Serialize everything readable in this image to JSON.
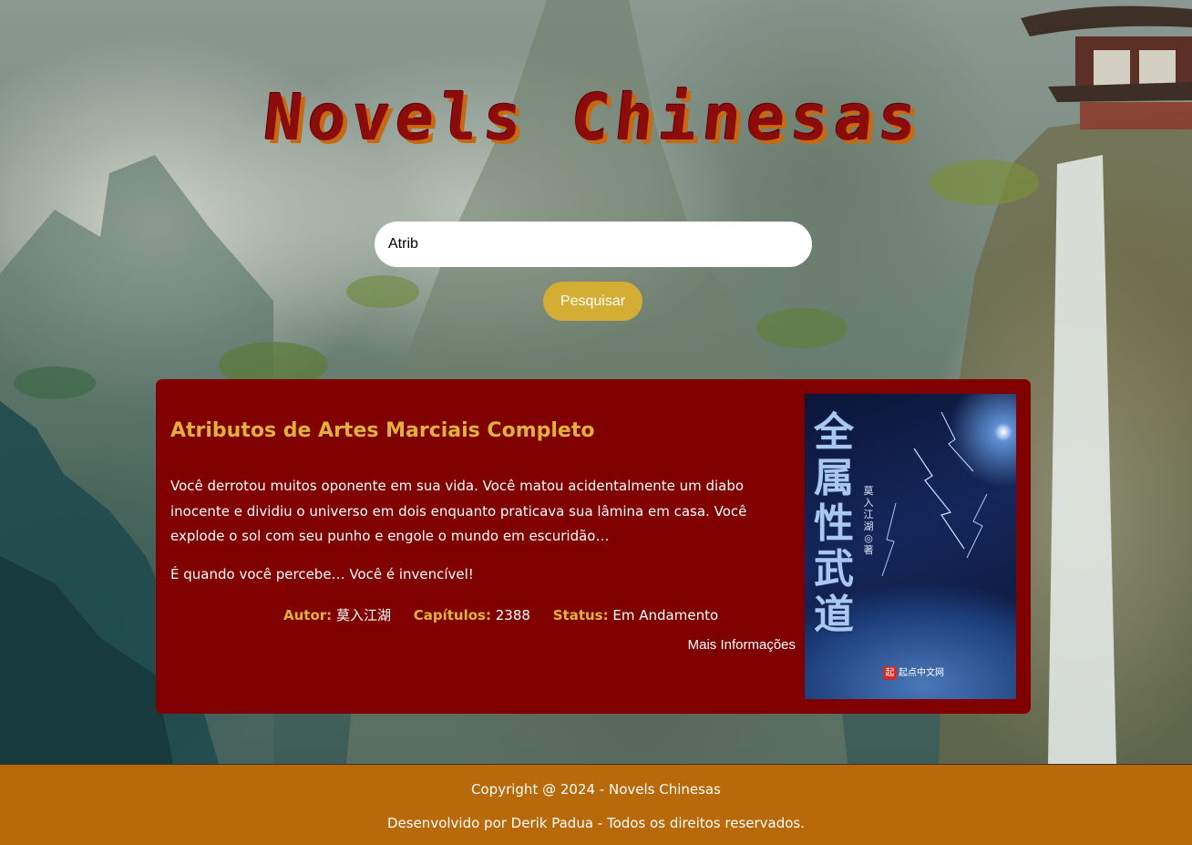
{
  "header": {
    "title": "Novels Chinesas"
  },
  "search": {
    "value": "Atrib",
    "button_label": "Pesquisar"
  },
  "result": {
    "title": "Atributos de Artes Marciais Completo",
    "description": "Você derrotou muitos oponente em sua vida. Você matou acidentalmente um diabo inocente e dividiu o universo em dois enquanto praticava sua lâmina em casa. Você explode o sol com seu punho e engole o mundo em escuridão…",
    "description_2": "É quando você percebe… Você é invencível!",
    "author_label": "Autor:",
    "author_value": "莫入江湖",
    "chapters_label": "Capítulos:",
    "chapters_value": "2388",
    "status_label": "Status:",
    "status_value": "Em Andamento",
    "more_link": "Mais Informações",
    "cover": {
      "title": "全属性武道",
      "author": "莫入江湖◎著",
      "publisher_mark": "起",
      "publisher": "起点中文网"
    }
  },
  "footer": {
    "copyright": "Copyright @ 2024 - Novels Chinesas",
    "credits": "Desenvolvido por Derik Padua - Todos os direitos reservados."
  },
  "colors": {
    "card_bg": "#800000",
    "accent_gold": "#d4ad34",
    "footer_bg": "#b8690a",
    "title_red": "#8c0c0c"
  }
}
